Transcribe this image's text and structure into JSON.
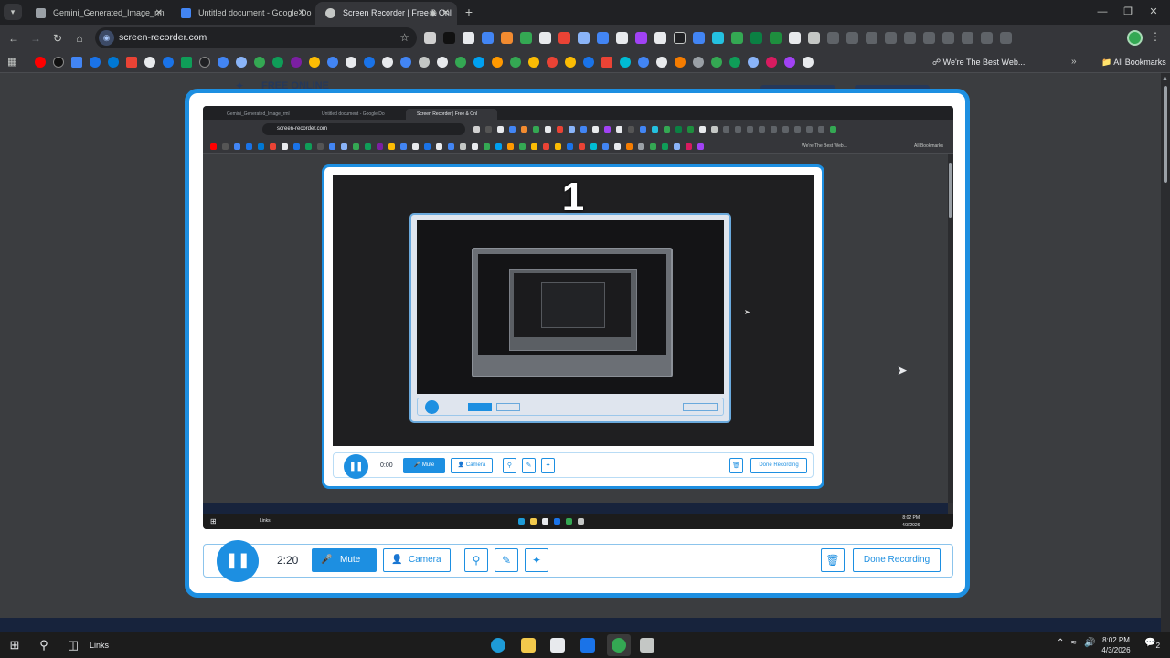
{
  "browser": {
    "tabs": [
      {
        "title": "Gemini_Generated_Image_rml",
        "favicon_color": "#9aa0a6",
        "active": false
      },
      {
        "title": "Untitled document - Google Do",
        "favicon_color": "#4285f4",
        "active": false
      },
      {
        "title": "Screen Recorder | Free & Onl",
        "favicon_color": "#c4c7c5",
        "active": true
      }
    ],
    "new_tab_label": "+",
    "address": "screen-recorder.com",
    "bookmarks": {
      "named_item": "We're The Best Web...",
      "all_bookmarks_label": "All Bookmarks",
      "more_label": "»"
    }
  },
  "page_background": {
    "heading": "FREE ONLINE"
  },
  "recorder": {
    "timer": "2:20",
    "mute_label": "Mute",
    "camera_label": "Camera",
    "done_label": "Done Recording",
    "nested": {
      "timer": "0:00",
      "mute_label": "Mute",
      "camera_label": "Camera",
      "done_label": "Done Recording",
      "countdown": "1",
      "tabs": [
        "Gemini_Generated_Image_rml",
        "Untitled document - Google Do",
        "Screen Recorder | Free & Onl"
      ],
      "address": "screen-recorder.com",
      "bookmark_item": "We're The Best Web...",
      "all_bookmarks_label": "All Bookmarks",
      "taskbar_links": "Links",
      "time": "8:02 PM",
      "date": "4/3/2026"
    }
  },
  "taskbar": {
    "links_label": "Links",
    "time": "8:02 PM",
    "date": "4/3/2026",
    "notification_count": "2"
  },
  "colors": {
    "accent": "#1d8fe1",
    "chrome_dark": "#202124",
    "chrome_toolbar": "#35363a"
  }
}
